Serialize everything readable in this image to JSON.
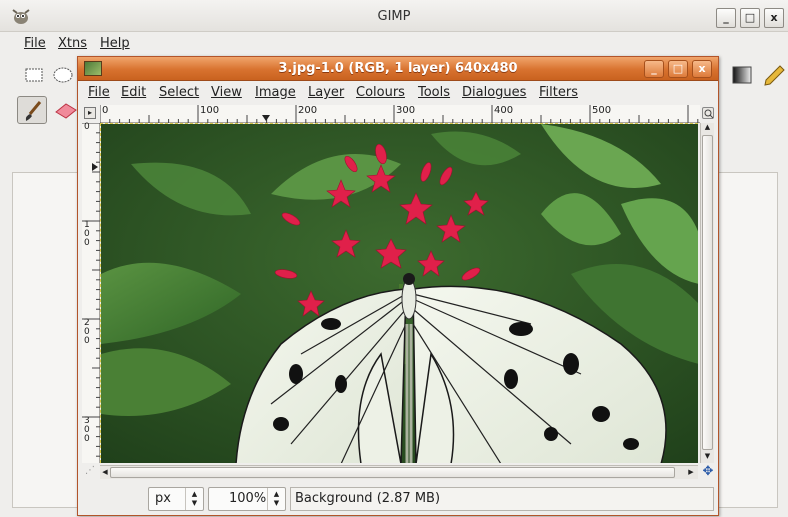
{
  "main_window": {
    "title": "GIMP",
    "menu": [
      "File",
      "Xtns",
      "Help"
    ],
    "controls": {
      "minimize": "_",
      "maximize": "□",
      "close": "x"
    }
  },
  "image_window": {
    "title": "3.jpg-1.0 (RGB, 1 layer) 640x480",
    "controls": {
      "minimize": "_",
      "maximize": "□",
      "close": "x"
    },
    "menu": [
      "File",
      "Edit",
      "Select",
      "View",
      "Image",
      "Layer",
      "Colours",
      "Tools",
      "Dialogues",
      "Filters"
    ],
    "ruler_h_labels": [
      "0",
      "100",
      "200",
      "300",
      "400",
      "500"
    ],
    "ruler_v_labels": [
      "0",
      "100",
      "200",
      "300"
    ],
    "status": {
      "unit": "px",
      "zoom": "100%",
      "info": "Background (2.87 MB)"
    }
  },
  "colors": {
    "title_orange": "#d8722f",
    "canvas_green": "#2f5a27",
    "flower_pink": "#e0204a"
  }
}
